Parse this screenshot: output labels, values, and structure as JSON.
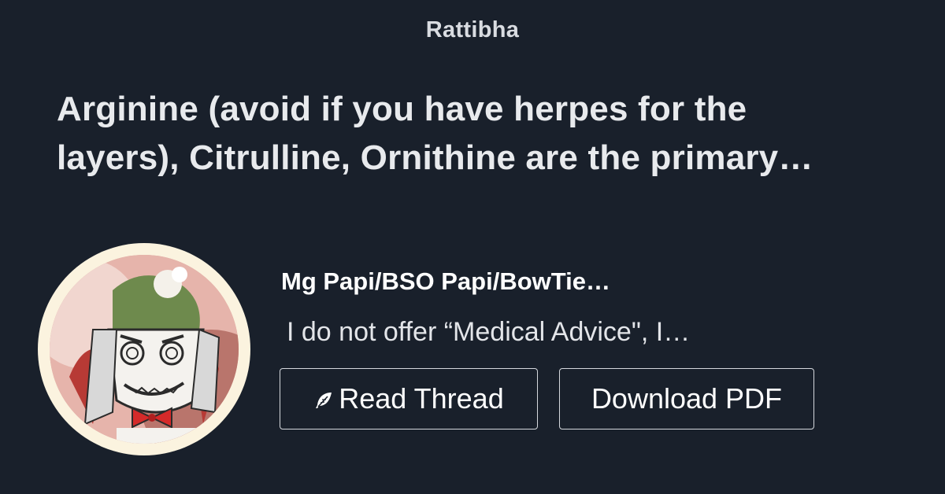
{
  "brand": "Rattibha",
  "headline": {
    "line1": "Arginine (avoid if you have herpes for the",
    "line2": "layers), Citrulline, Ornithine are the primary…"
  },
  "author": {
    "name": "Mg Papi/BSO Papi/BowTie…",
    "bio": "I do not offer “Medical Advice\", I…"
  },
  "actions": {
    "read_label": "Read Thread",
    "read_icon": "feather-icon",
    "pdf_label": "Download PDF"
  },
  "colors": {
    "background": "#19202b",
    "text": "#e8eaed",
    "button_border": "#d5d8dd"
  }
}
